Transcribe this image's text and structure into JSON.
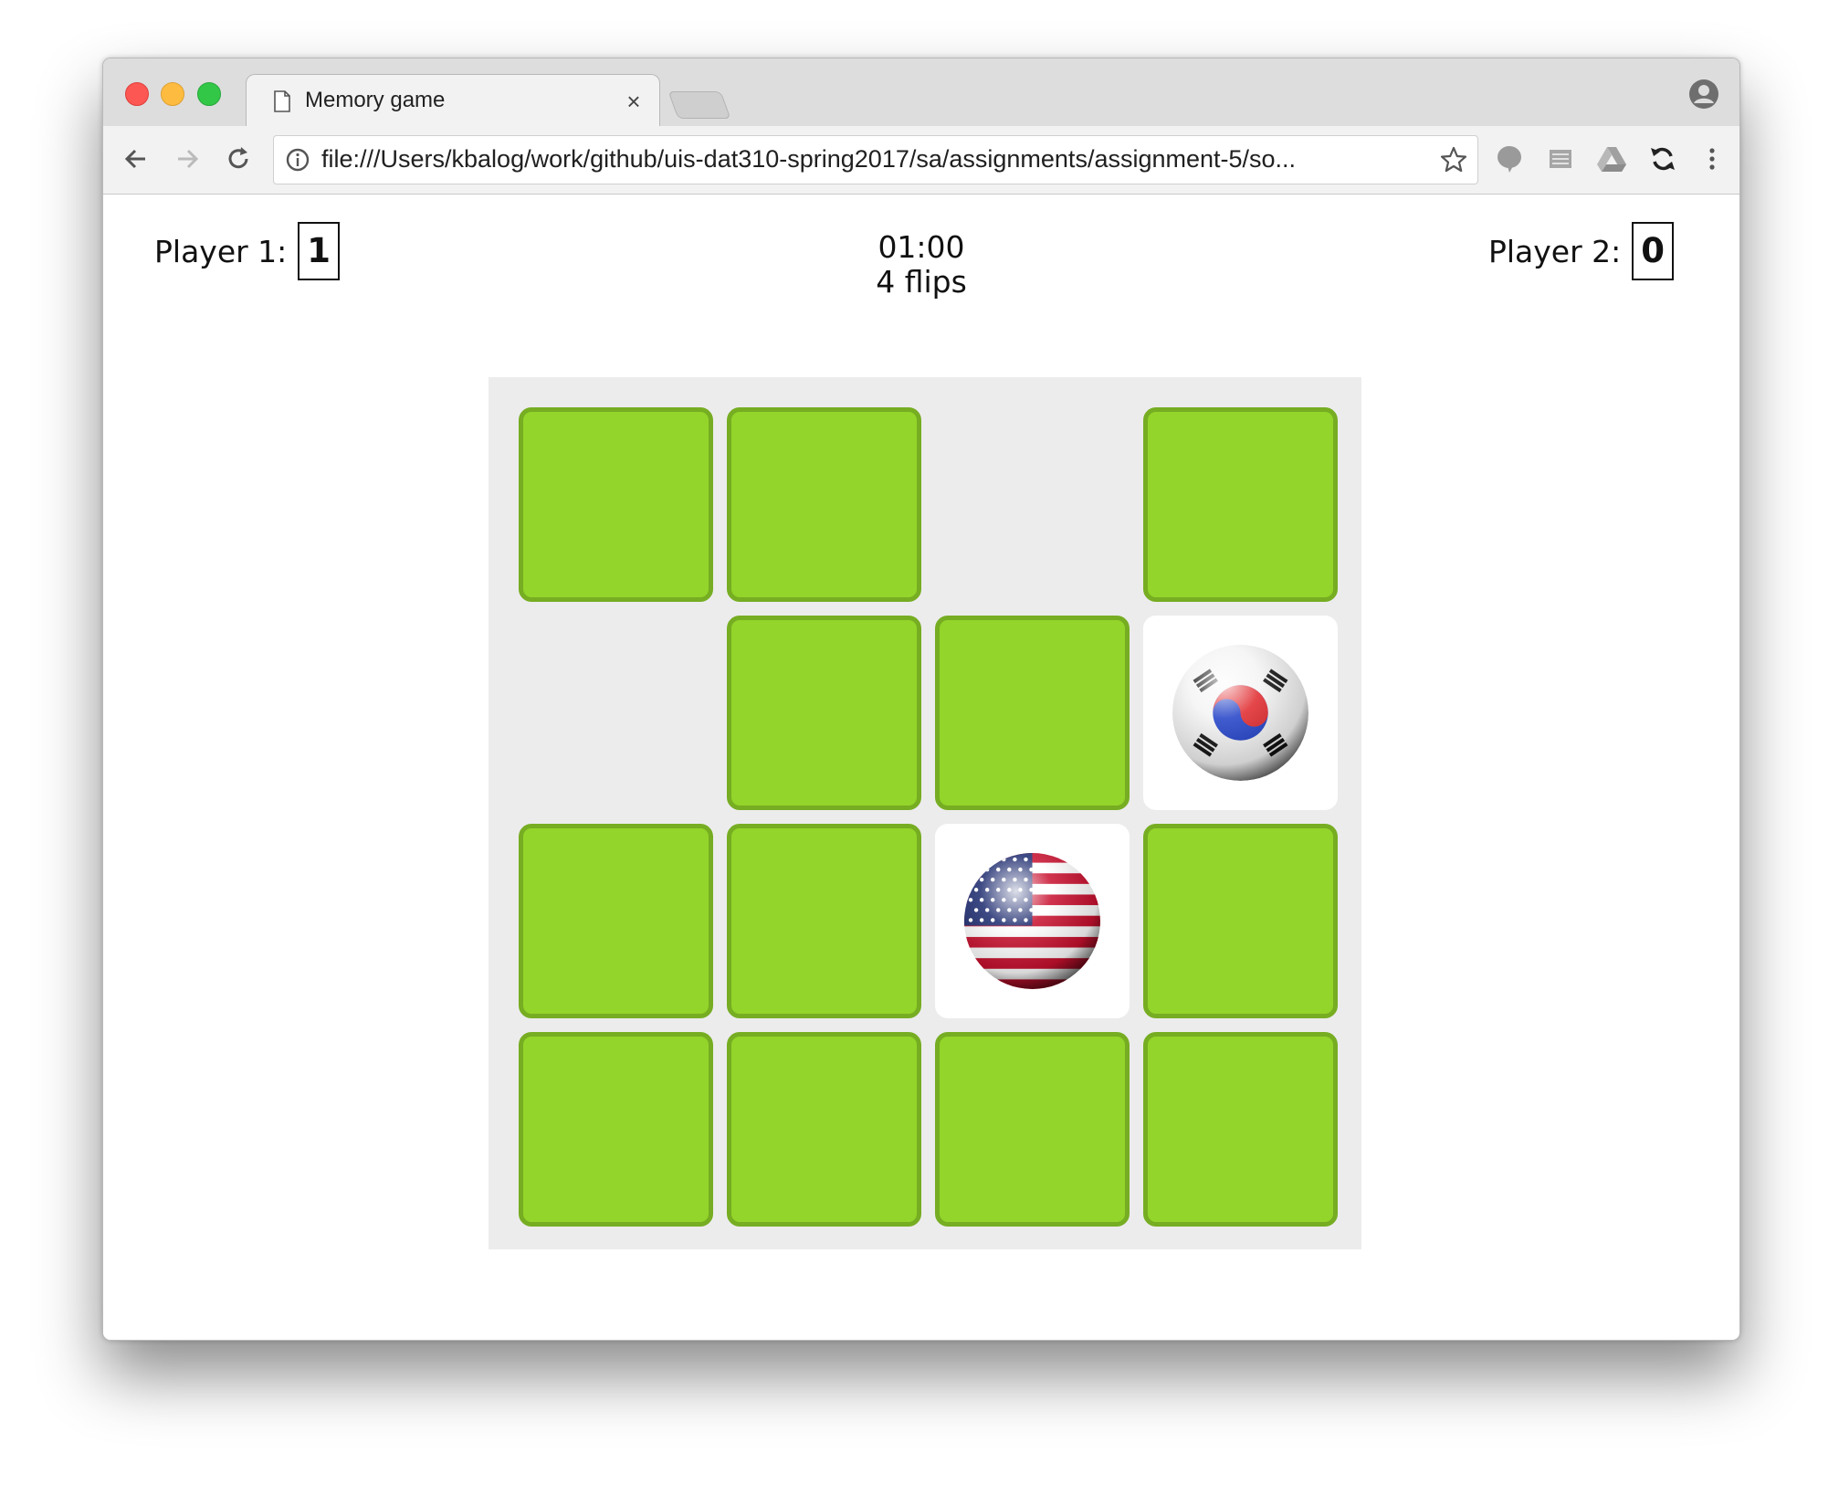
{
  "browser": {
    "tab_title": "Memory game",
    "tab_close": "×",
    "url": "file:///Users/kbalog/work/github/uis-dat310-spring2017/sa/assignments/assignment-5/so..."
  },
  "game": {
    "player1": {
      "label": "Player 1:",
      "score": "1"
    },
    "player2": {
      "label": "Player 2:",
      "score": "0"
    },
    "timer": "01:00",
    "flips": "4 flips",
    "board": {
      "rows": 4,
      "cols": 4,
      "cards": [
        "down",
        "down",
        "matched",
        "down",
        "matched",
        "down",
        "down",
        "flag-korea",
        "down",
        "down",
        "flag-usa",
        "down",
        "down",
        "down",
        "down",
        "down"
      ]
    },
    "colors": {
      "card_back": "#93d52a",
      "card_border": "#76ad22",
      "board_bg": "#ececec"
    }
  }
}
